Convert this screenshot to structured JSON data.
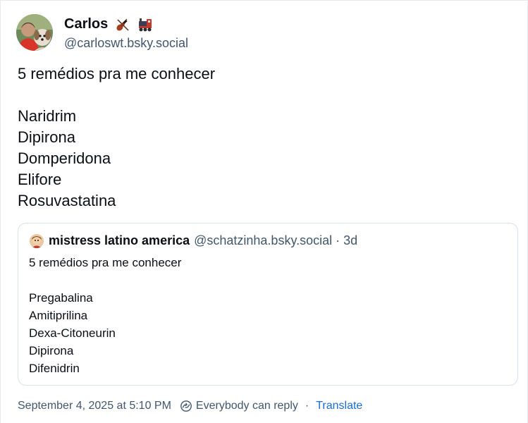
{
  "author": {
    "display_name": "Carlos",
    "handle": "@carloswt.bsky.social",
    "name_emoji_1": "violin-emoji",
    "name_emoji_2": "locomotive-emoji"
  },
  "post": {
    "text": "5 remédios pra me conhecer\n\nNaridrim\nDipirona\nDomperidona\nElifore\nRosuvastatina"
  },
  "quote": {
    "display_name": "mistress latino america",
    "handle": "@schatzinha.bsky.social",
    "separator": "·",
    "time": "3d",
    "text": "5 remédios pra me conhecer\n\nPregabalina\nAmitiprilina\nDexa-Citoneurin\nDipirona\nDifenidrin"
  },
  "footer": {
    "timestamp": "September 4, 2025 at 5:10 PM",
    "reply_setting": "Everybody can reply",
    "separator": "·",
    "translate_label": "Translate"
  },
  "colors": {
    "text": "#0b0f14",
    "muted": "#42576c",
    "link": "#1a6dd8",
    "border": "#dbe2e8"
  }
}
